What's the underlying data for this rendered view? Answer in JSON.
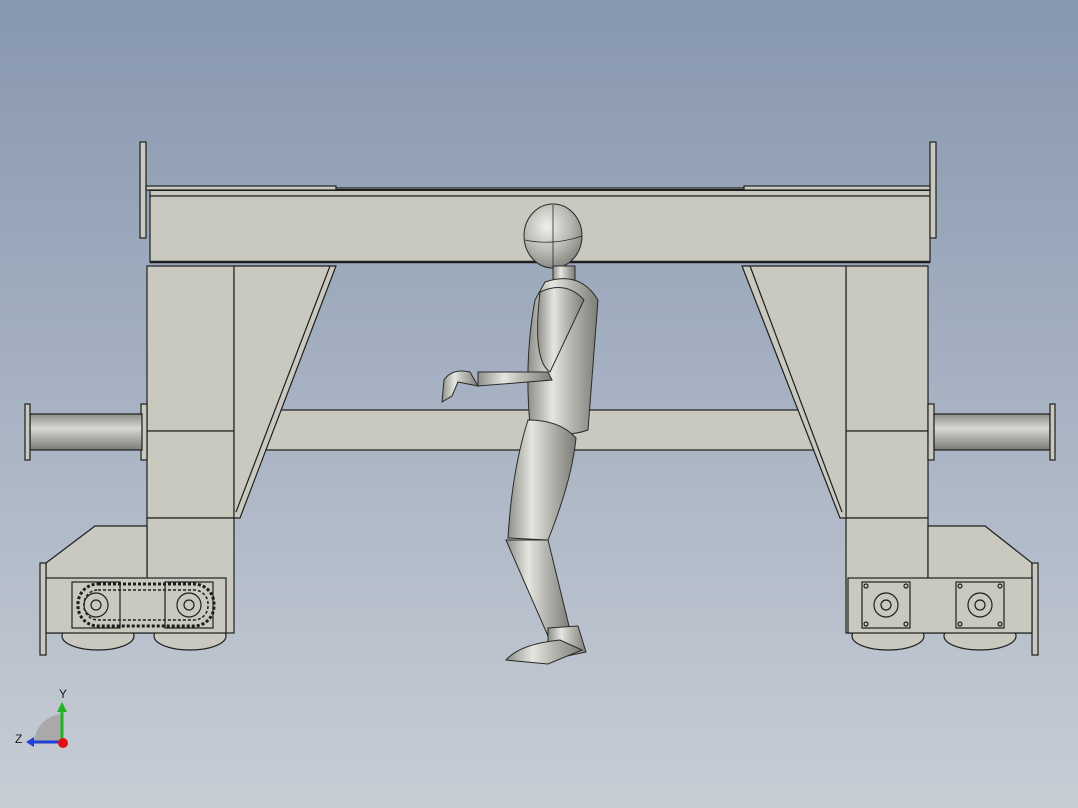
{
  "viewport": {
    "background_top": "#8797ae",
    "background_bottom": "#c7cdd5"
  },
  "model": {
    "part_color": "#c9c9c0",
    "edge_color": "#1e1e1e",
    "figure_color": "#b4b6ae"
  },
  "triad": {
    "y_label": "Y",
    "z_label": "Z",
    "y_color": "#22b322",
    "z_color": "#1f3fd6",
    "x_color": "#e01010",
    "arc_icon": "view-orientation-triad"
  }
}
